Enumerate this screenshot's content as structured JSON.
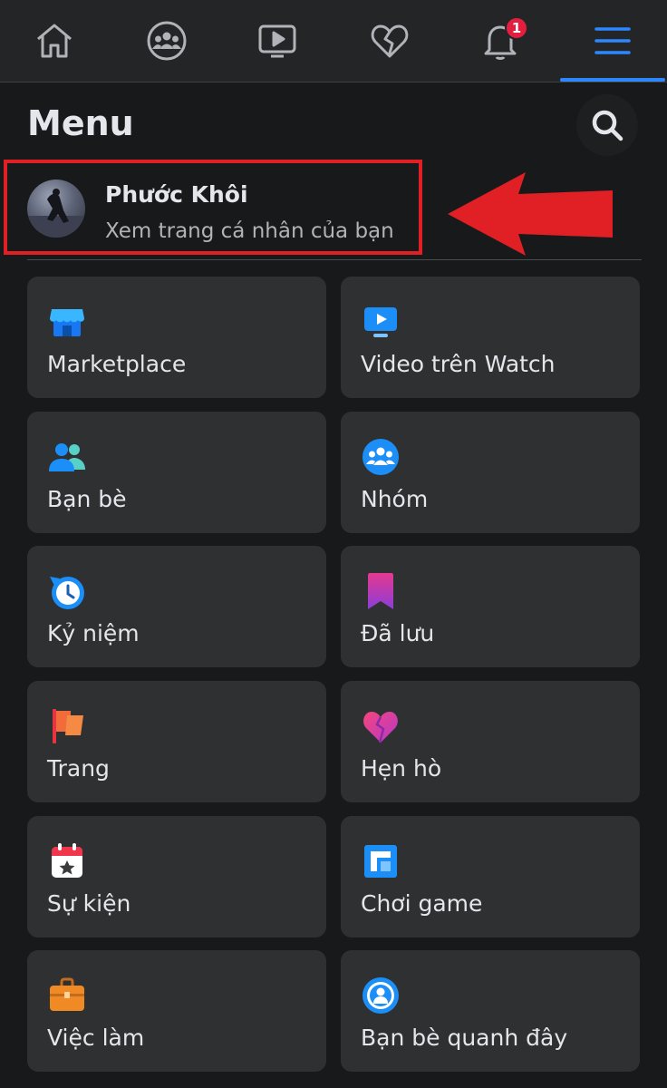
{
  "nav": {
    "items": [
      {
        "icon": "home-icon"
      },
      {
        "icon": "groups-icon"
      },
      {
        "icon": "watch-icon"
      },
      {
        "icon": "dating-icon"
      },
      {
        "icon": "bell-icon",
        "badge": "1"
      },
      {
        "icon": "hamburger-menu-icon",
        "active": true
      }
    ],
    "accent": "#2d88ff",
    "badge_color": "#e41e3f"
  },
  "header": {
    "title": "Menu",
    "search_icon": "search-icon"
  },
  "profile": {
    "name": "Phước Khôi",
    "subtitle": "Xem trang cá nhân của bạn",
    "annotation_color": "#e02025"
  },
  "shortcuts": [
    {
      "label": "Marketplace",
      "icon": "marketplace-icon"
    },
    {
      "label": "Video trên Watch",
      "icon": "watch-video-icon"
    },
    {
      "label": "Bạn bè",
      "icon": "friends-icon"
    },
    {
      "label": "Nhóm",
      "icon": "groups-icon"
    },
    {
      "label": "Kỷ niệm",
      "icon": "memories-icon"
    },
    {
      "label": "Đã lưu",
      "icon": "saved-icon"
    },
    {
      "label": "Trang",
      "icon": "pages-flag-icon"
    },
    {
      "label": "Hẹn hò",
      "icon": "dating-heart-icon"
    },
    {
      "label": "Sự kiện",
      "icon": "events-calendar-icon"
    },
    {
      "label": "Chơi game",
      "icon": "gaming-icon"
    },
    {
      "label": "Việc làm",
      "icon": "jobs-briefcase-icon"
    },
    {
      "label": "Bạn bè quanh đây",
      "icon": "nearby-friends-icon"
    }
  ]
}
